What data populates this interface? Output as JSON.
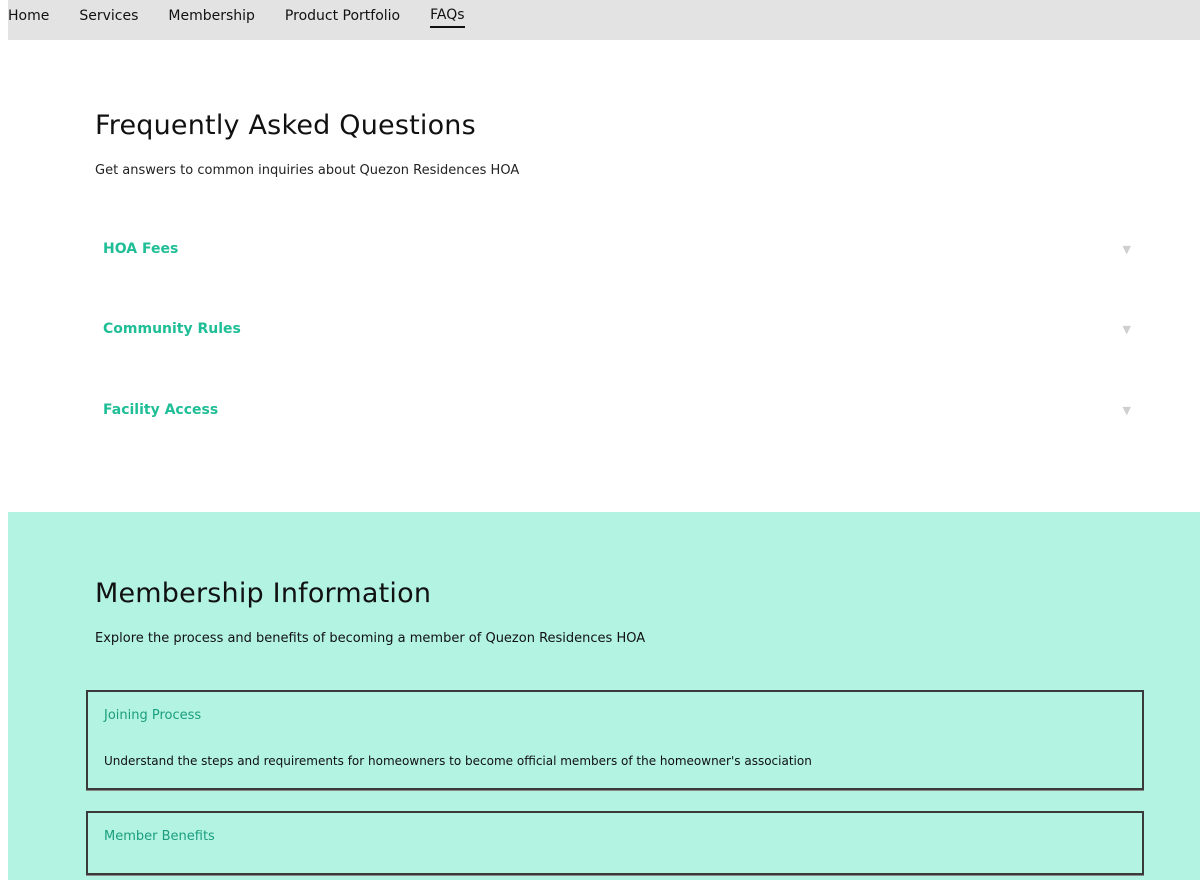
{
  "nav": {
    "items": [
      {
        "label": "Home"
      },
      {
        "label": "Services"
      },
      {
        "label": "Membership"
      },
      {
        "label": "Product Portfolio"
      },
      {
        "label": "FAQs",
        "active": true
      }
    ]
  },
  "faq": {
    "title": "Frequently Asked Questions",
    "subtitle": "Get answers to common inquiries about Quezon Residences HOA",
    "items": [
      {
        "question": "HOA Fees",
        "icon": "chevron-down-icon"
      },
      {
        "question": "Community Rules",
        "icon": "chevron-down-icon"
      },
      {
        "question": "Facility Access",
        "icon": "chevron-down-icon"
      }
    ]
  },
  "membership": {
    "title": "Membership Information",
    "subtitle": "Explore the process and benefits of becoming a member of Quezon Residences HOA",
    "cards": [
      {
        "title": "Joining Process",
        "text": "Understand the steps and requirements for homeowners to become official members of the homeowner's association"
      },
      {
        "title": "Member Benefits",
        "text": ""
      }
    ]
  },
  "colors": {
    "accent": "#1fbe96",
    "membership_bg": "#b2f3e1",
    "topbar_bg": "#e3e3e3"
  }
}
